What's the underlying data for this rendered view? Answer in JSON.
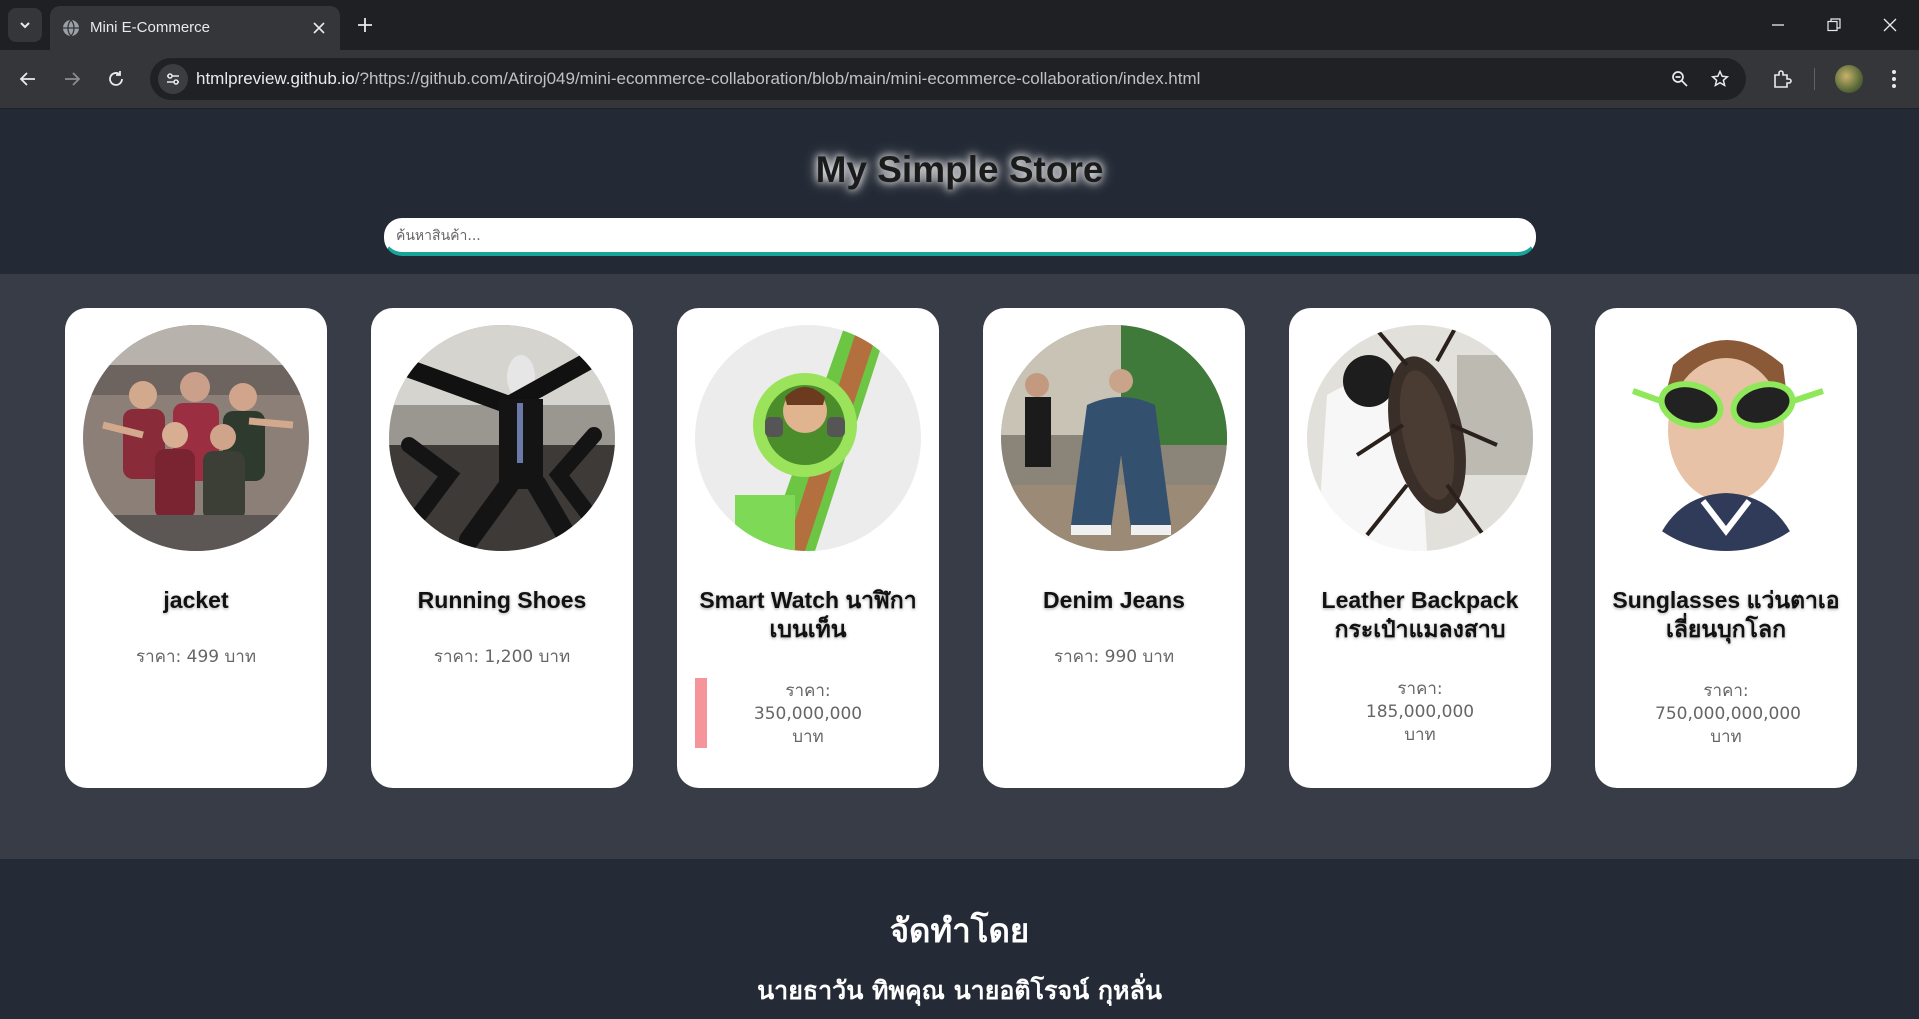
{
  "browser": {
    "tab_title": "Mini E-Commerce",
    "url_host": "htmlpreview.github.io",
    "url_rest": "/?https://github.com/Atiroj049/mini-ecommerce-collaboration/blob/main/mini-ecommerce-collaboration/index.html"
  },
  "header": {
    "title": "My Simple Store",
    "search_placeholder": "ค้นหาสินค้า..."
  },
  "products": [
    {
      "name": "jacket",
      "price_lines": [
        "ราคา: 499 บาท"
      ],
      "image": "group-photo-jacket"
    },
    {
      "name": "Running Shoes",
      "price_lines": [
        "ราคา: 1,200 บาท"
      ],
      "image": "mannequin-running-shoes"
    },
    {
      "name": "Smart Watch นาฬิกาเบนเท็น",
      "price_lines": [
        "ราคา:",
        "350,000,000",
        "บาท"
      ],
      "image": "green-toy-smartwatch"
    },
    {
      "name": "Denim Jeans",
      "price_lines": [
        "ราคา: 990 บาท"
      ],
      "image": "oversized-denim-jeans"
    },
    {
      "name": "Leather Backpack กระเป๋าแมลงสาบ",
      "price_lines": [
        "ราคา:",
        "185,000,000",
        "บาท"
      ],
      "image": "cockroach-backpack"
    },
    {
      "name": "Sunglasses แว่นตาเอเลี่ยนบุกโลก",
      "price_lines": [
        "ราคา:",
        "750,000,000,000",
        "บาท"
      ],
      "image": "alien-sunglasses"
    }
  ],
  "footer": {
    "title": "จัดทำโดย",
    "authors": "นายธาวัน ทิพคุณ นายอติโรจน์ กุหลั่น"
  },
  "colors": {
    "header_bg": "#242a35",
    "products_bg": "#373c47",
    "search_accent": "#1aa39a",
    "card_bg": "#ffffff"
  }
}
